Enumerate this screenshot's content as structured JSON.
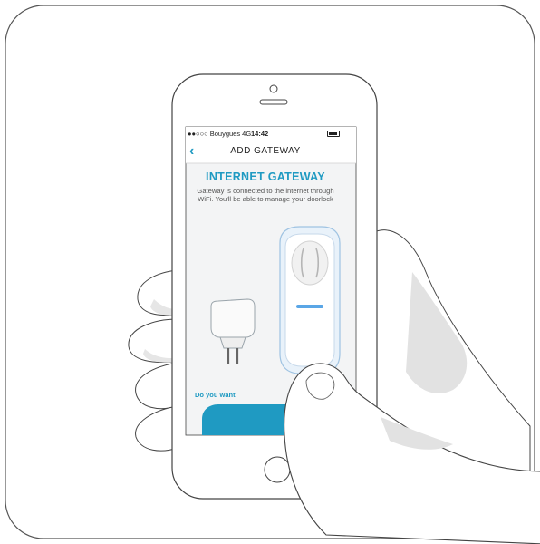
{
  "status_bar": {
    "carrier": "●●○○○ Bouygues  4G",
    "time": "14:42"
  },
  "nav": {
    "back_icon": "chevron-left-icon",
    "title": "ADD GATEWAY"
  },
  "content": {
    "headline": "INTERNET GATEWAY",
    "description": "Gateway is connected to the internet through WiFi. You'll be able to manage your doorlock",
    "question": "Do you want"
  },
  "colors": {
    "accent": "#1f9ac2",
    "led": "#5aa6e6",
    "outline": "#444444"
  }
}
